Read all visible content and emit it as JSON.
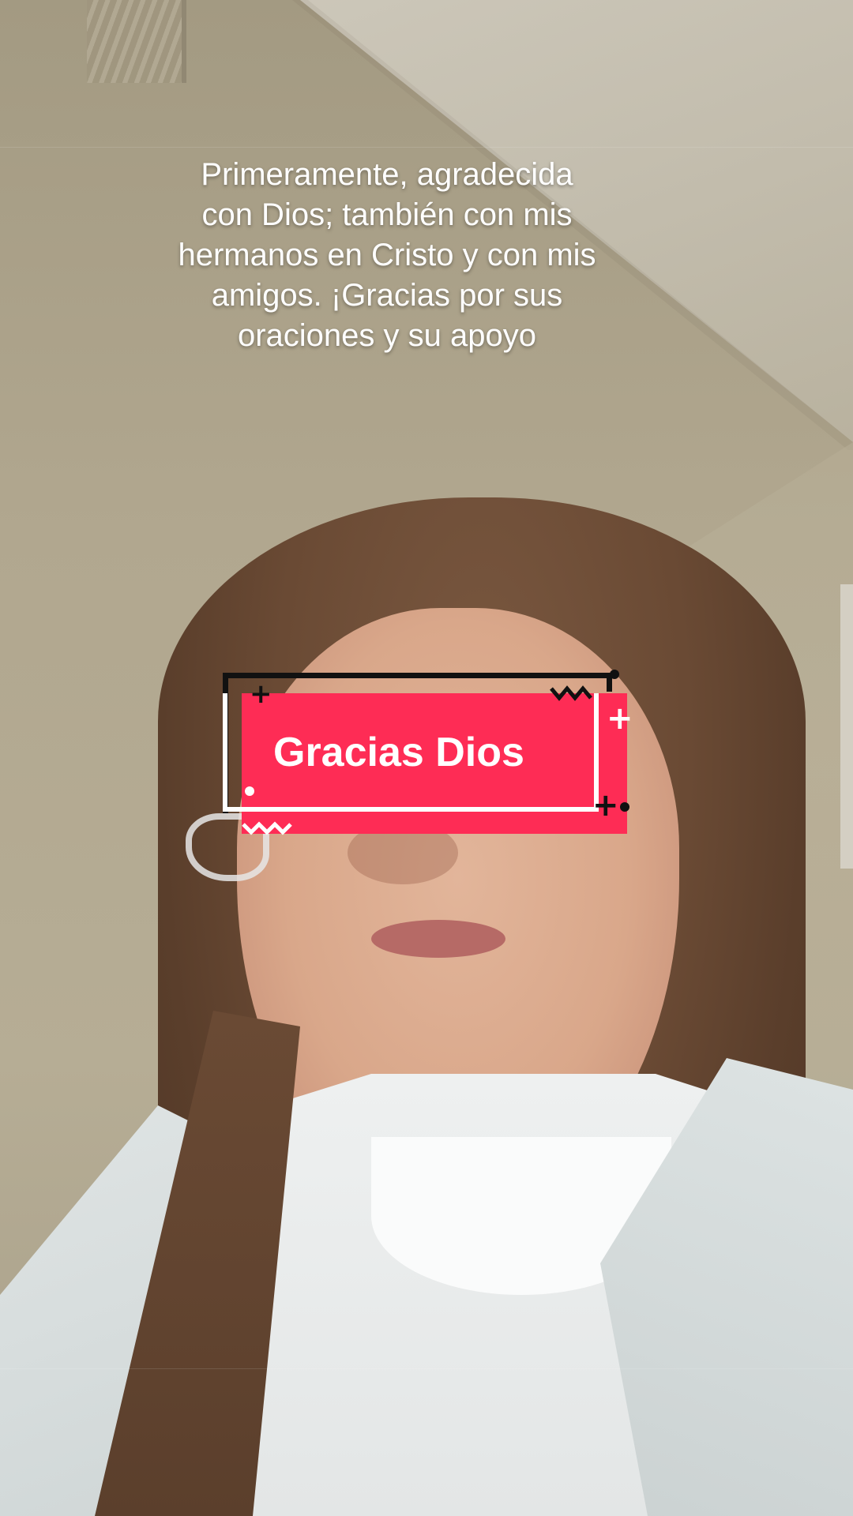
{
  "caption": {
    "lines": [
      "Primeramente, agradecida",
      "con Dios; también con mis",
      "hermanos en Cristo y con mis",
      "amigos. ¡Gracias por sus",
      "oraciones y su apoyo"
    ]
  },
  "sticker": {
    "label": "Gracias Dios",
    "accent_color": "#fe2c55"
  }
}
